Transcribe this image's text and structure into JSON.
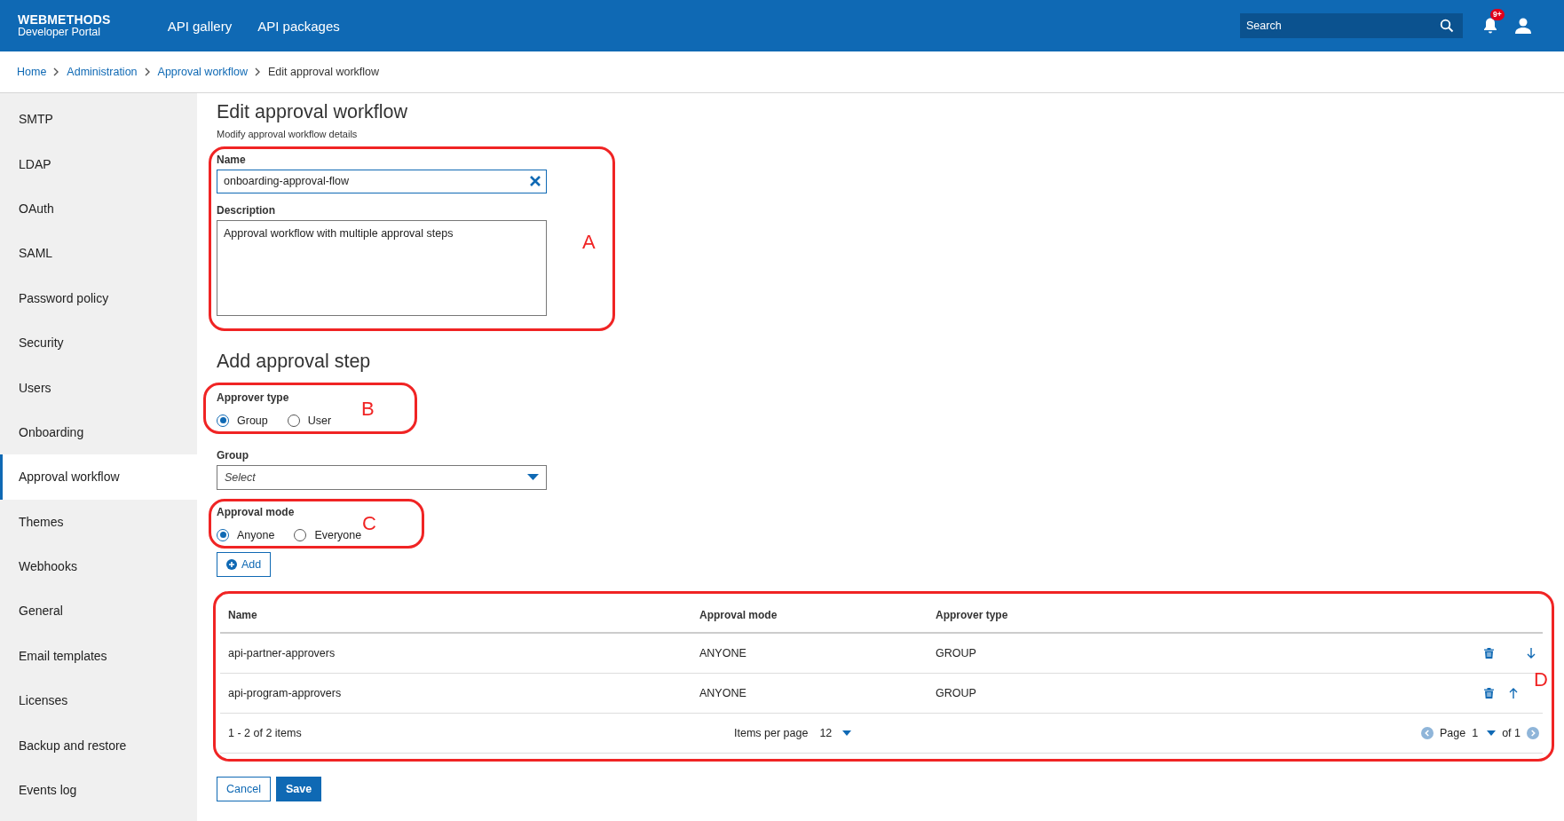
{
  "header": {
    "logo_title": "WEBMETHODS",
    "logo_subtitle": "Developer Portal",
    "nav": [
      "API gallery",
      "API packages"
    ],
    "search": {
      "placeholder": "Search"
    },
    "notification_badge": "9+"
  },
  "breadcrumb": [
    {
      "label": "Home",
      "kind": "link"
    },
    {
      "label": "Administration",
      "kind": "link"
    },
    {
      "label": "Approval workflow",
      "kind": "link"
    },
    {
      "label": "Edit approval workflow",
      "kind": "current"
    }
  ],
  "sidebar": {
    "items": [
      {
        "label": "SMTP",
        "selected": false
      },
      {
        "label": "LDAP",
        "selected": false
      },
      {
        "label": "OAuth",
        "selected": false
      },
      {
        "label": "SAML",
        "selected": false
      },
      {
        "label": "Password policy",
        "selected": false
      },
      {
        "label": "Security",
        "selected": false
      },
      {
        "label": "Users",
        "selected": false
      },
      {
        "label": "Onboarding",
        "selected": false
      },
      {
        "label": "Approval workflow",
        "selected": true
      },
      {
        "label": "Themes",
        "selected": false
      },
      {
        "label": "Webhooks",
        "selected": false
      },
      {
        "label": "General",
        "selected": false
      },
      {
        "label": "Email templates",
        "selected": false
      },
      {
        "label": "Licenses",
        "selected": false
      },
      {
        "label": "Backup and restore",
        "selected": false
      },
      {
        "label": "Events log",
        "selected": false
      }
    ]
  },
  "form": {
    "title": "Edit approval workflow",
    "subtitle": "Modify approval workflow details",
    "annotation": "A",
    "name": {
      "label": "Name",
      "value": "onboarding-approval-flow"
    },
    "description": {
      "label": "Description",
      "value": "Approval workflow with multiple approval steps"
    }
  },
  "approval_step": {
    "title": "Add approval step",
    "approver_type": {
      "label": "Approver type",
      "annotation": "B",
      "options": [
        {
          "label": "Group",
          "selected": true
        },
        {
          "label": "User",
          "selected": false
        }
      ]
    },
    "group": {
      "label": "Group",
      "placeholder": "Select"
    },
    "approval_mode": {
      "label": "Approval mode",
      "annotation": "C",
      "options": [
        {
          "label": "Anyone",
          "selected": true
        },
        {
          "label": "Everyone",
          "selected": false
        }
      ]
    },
    "add_button": "Add"
  },
  "table": {
    "annotation": "D",
    "columns": [
      "Name",
      "Approval mode",
      "Approver type"
    ],
    "rows": [
      {
        "cells": [
          "api-partner-approvers",
          "ANYONE",
          "GROUP"
        ],
        "kind": "move-down"
      },
      {
        "cells": [
          "api-program-approvers",
          "ANYONE",
          "GROUP"
        ],
        "kind": "move-up"
      }
    ],
    "footer": {
      "range": "1 - 2 of 2 items",
      "items_per_page_label": "Items per page",
      "items_per_page": "12",
      "page_label": "Page",
      "page": "1",
      "page_total": "of 1"
    }
  },
  "buttons": {
    "cancel": "Cancel",
    "save": "Save"
  }
}
